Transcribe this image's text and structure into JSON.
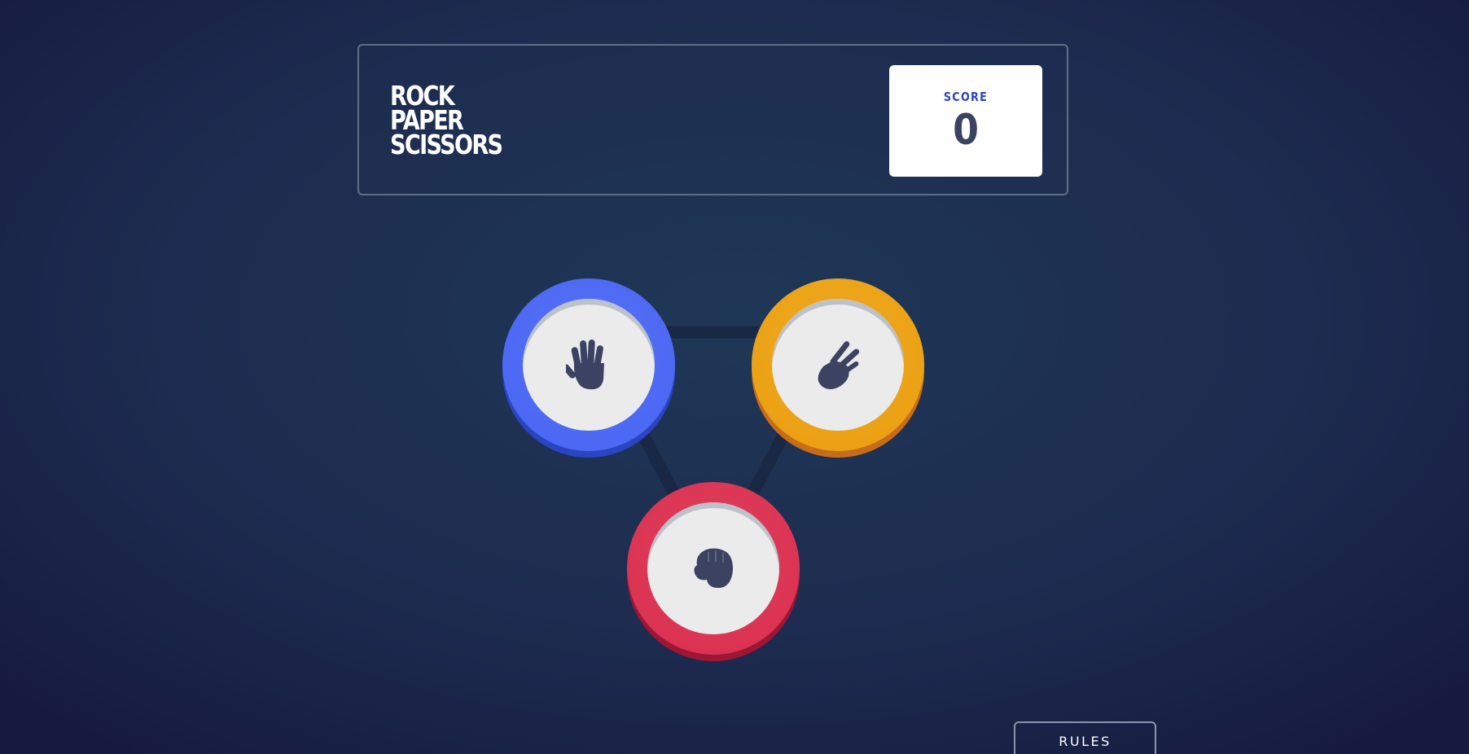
{
  "header": {
    "title_lines": [
      "ROCK",
      "PAPER",
      "SCISSORS"
    ],
    "score_label": "SCORE",
    "score_value": "0"
  },
  "choices": [
    {
      "id": "paper",
      "icon": "paper-hand-icon",
      "color": "#4865f4",
      "shadow": "#2a45c2"
    },
    {
      "id": "scissors",
      "icon": "scissors-hand-icon",
      "color": "#ec9e0e",
      "shadow": "#c76c1b"
    },
    {
      "id": "rock",
      "icon": "rock-fist-icon",
      "color": "#dc2e4e",
      "shadow": "#9d1634"
    }
  ],
  "rules_button": {
    "label": "RULES"
  },
  "colors": {
    "background_dark": "#161940",
    "background_light": "#1f3756",
    "header_outline": "#606e85",
    "score_text": "#3b4363",
    "score_label": "#2a46c0"
  }
}
